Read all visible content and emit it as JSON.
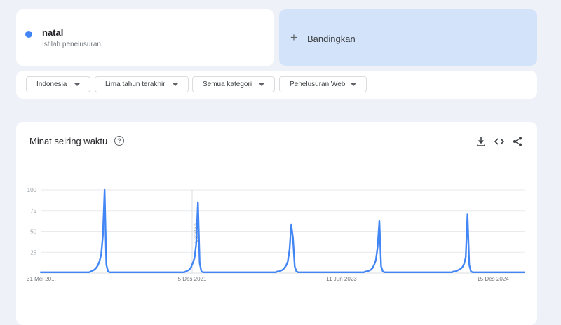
{
  "term": {
    "name": "natal",
    "subtitle": "Istilah penelusuran",
    "color": "#4285f4"
  },
  "compare": {
    "plus": "+",
    "label": "Bandingkan"
  },
  "filters": [
    {
      "label": "Indonesia"
    },
    {
      "label": "Lima tahun terakhir"
    },
    {
      "label": "Semua kategori"
    },
    {
      "label": "Penelusuran Web"
    }
  ],
  "panel": {
    "title": "Minat seiring waktu",
    "help": "?",
    "icons": [
      "download-icon",
      "embed-icon",
      "share-icon"
    ]
  },
  "chart_data": {
    "type": "line",
    "ylim": [
      0,
      100
    ],
    "yticks": [
      25,
      50,
      75,
      100
    ],
    "grid": true,
    "x_tick_labels": [
      "31 Mei 20...",
      "5 Des 2021",
      "11 Jun 2023",
      "15 Des 2024"
    ],
    "annotation": "Catatan",
    "series": [
      {
        "color": "#4285f4",
        "values": [
          1,
          1,
          1,
          1,
          1,
          1,
          1,
          1,
          1,
          1,
          1,
          1,
          1,
          1,
          1,
          1,
          1,
          1,
          1,
          1,
          1,
          1,
          1,
          1,
          1,
          1,
          1,
          1,
          1,
          2,
          3,
          4,
          6,
          9,
          14,
          22,
          45,
          100,
          10,
          2,
          1,
          1,
          1,
          1,
          1,
          1,
          1,
          1,
          1,
          1,
          1,
          1,
          1,
          1,
          1,
          1,
          1,
          1,
          1,
          1,
          1,
          1,
          1,
          1,
          1,
          1,
          1,
          1,
          1,
          1,
          1,
          1,
          1,
          1,
          1,
          1,
          1,
          1,
          1,
          1,
          1,
          1,
          1,
          1,
          2,
          3,
          4,
          7,
          12,
          18,
          35,
          85,
          12,
          2,
          1,
          1,
          1,
          1,
          1,
          1,
          1,
          1,
          1,
          1,
          1,
          1,
          1,
          1,
          1,
          1,
          1,
          1,
          1,
          1,
          1,
          1,
          1,
          1,
          1,
          1,
          1,
          1,
          1,
          1,
          1,
          1,
          1,
          1,
          1,
          1,
          1,
          1,
          1,
          1,
          1,
          1,
          1,
          2,
          2,
          3,
          4,
          6,
          9,
          14,
          28,
          58,
          42,
          8,
          2,
          1,
          1,
          1,
          1,
          1,
          1,
          1,
          1,
          1,
          1,
          1,
          1,
          1,
          1,
          1,
          1,
          1,
          1,
          1,
          1,
          1,
          1,
          1,
          1,
          1,
          1,
          1,
          1,
          1,
          1,
          1,
          1,
          1,
          1,
          1,
          1,
          1,
          1,
          1,
          2,
          2,
          3,
          4,
          6,
          10,
          16,
          32,
          63,
          8,
          2,
          1,
          1,
          1,
          1,
          1,
          1,
          1,
          1,
          1,
          1,
          1,
          1,
          1,
          1,
          1,
          1,
          1,
          1,
          1,
          1,
          1,
          1,
          1,
          1,
          1,
          1,
          1,
          1,
          1,
          1,
          1,
          1,
          1,
          1,
          1,
          1,
          1,
          1,
          1,
          1,
          2,
          2,
          3,
          4,
          5,
          7,
          11,
          19,
          71,
          10,
          2,
          1,
          1,
          1,
          1,
          1,
          1,
          1,
          1,
          1,
          1,
          1,
          1,
          1,
          1,
          1,
          1,
          1,
          1,
          1,
          1,
          1,
          1,
          1,
          1,
          1,
          1,
          1,
          1,
          1,
          1,
          1
        ]
      }
    ]
  }
}
